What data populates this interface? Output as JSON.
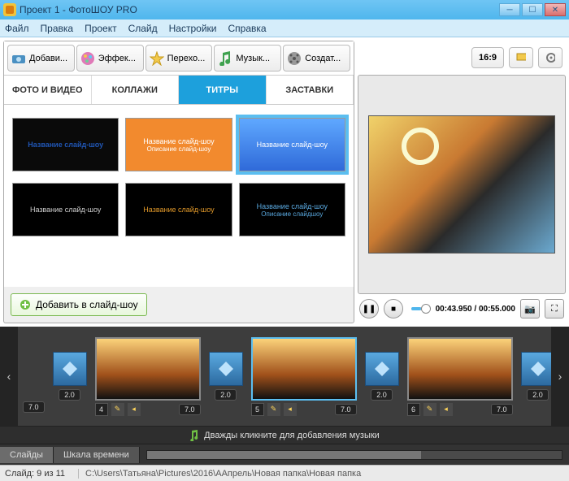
{
  "window": {
    "title": "Проект 1 - ФотоШОУ PRO"
  },
  "menu": {
    "file": "Файл",
    "edit": "Правка",
    "project": "Проект",
    "slide": "Слайд",
    "settings": "Настройки",
    "help": "Справка"
  },
  "toolbar": {
    "add": "Добави...",
    "effects": "Эффек...",
    "transitions": "Перехо...",
    "music": "Музык...",
    "create": "Создат..."
  },
  "right_toolbar": {
    "aspect": "16:9"
  },
  "categories": {
    "photo_video": "ФОТО И ВИДЕО",
    "collages": "КОЛЛАЖИ",
    "titles": "ТИТРЫ",
    "splash": "ЗАСТАВКИ",
    "active": "titles"
  },
  "titles_gallery": [
    {
      "line1": "Название слайд-шоу",
      "bg": "#0a0a0a",
      "fg": "#2056b5",
      "font": "bold"
    },
    {
      "line1": "Название слайд-шоу",
      "line2": "Описание слайд-шоу",
      "bg": "#f28a2e",
      "fg": "#ffffff"
    },
    {
      "line1": "Название слайд-шоу",
      "bg": "linear-gradient(#5fa8ff,#2f6ad9)",
      "fg": "#ffffff",
      "selected": true
    },
    {
      "line1": "Название слайд-шоу",
      "bg": "#000000",
      "fg": "#d0d0d0"
    },
    {
      "line1": "Название слайд-шоу",
      "bg": "#000000",
      "fg": "#e39a2a"
    },
    {
      "line1": "Название слайд-шоу",
      "line2": "Описание слайдшоу",
      "bg": "#000000",
      "fg": "#5aa9e0"
    }
  ],
  "add_button": "Добавить в слайд-шоу",
  "transport": {
    "time": "00:43.950 / 00:55.000"
  },
  "timeline": {
    "transitions_duration": "2.0",
    "slides": [
      {
        "num": "4",
        "dur": "7.0"
      },
      {
        "num": "5",
        "dur": "7.0",
        "selected": true
      },
      {
        "num": "6",
        "dur": "7.0"
      }
    ],
    "leading_dur": "7.0",
    "music_hint": "Дважды кликните для добавления музыки",
    "tab_slides": "Слайды",
    "tab_timeline": "Шкала времени"
  },
  "status": {
    "slide": "Слайд: 9 из 11",
    "path": "C:\\Users\\Татьяна\\Pictures\\2016\\ААпрель\\Новая папка\\Новая папка"
  }
}
